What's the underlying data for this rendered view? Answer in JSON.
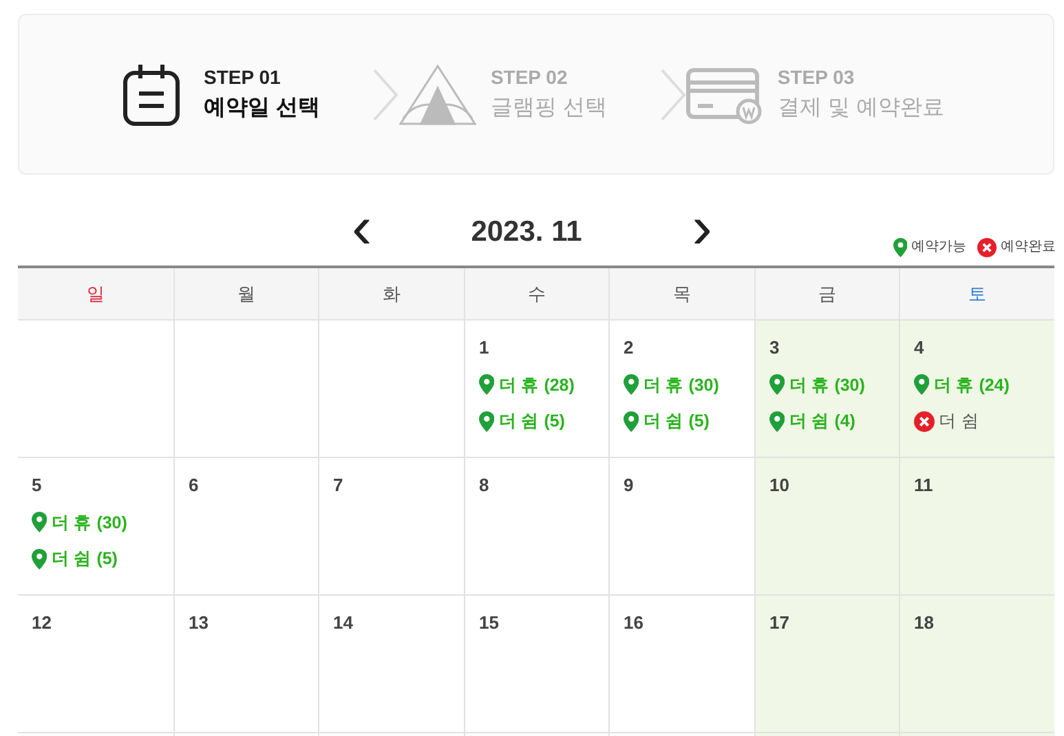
{
  "steps": [
    {
      "kind": "calendar",
      "number": "STEP 01",
      "label": "예약일 선택",
      "selected": true
    },
    {
      "kind": "tent",
      "number": "STEP 02",
      "label": "글램핑 선택",
      "selected": false
    },
    {
      "kind": "card",
      "number": "STEP 03",
      "label": "결제 및 예약완료",
      "selected": false
    }
  ],
  "calendar": {
    "prev": "‹",
    "title": "2023. 11",
    "next": "›",
    "legend": [
      {
        "kind": "available",
        "label": "예약가능"
      },
      {
        "kind": "booked",
        "label": "예약완료"
      }
    ],
    "weekdays": [
      {
        "label": "일",
        "color": "#e0263a"
      },
      {
        "label": "월",
        "color": "#555555"
      },
      {
        "label": "화",
        "color": "#555555"
      },
      {
        "label": "수",
        "color": "#555555"
      },
      {
        "label": "목",
        "color": "#555555"
      },
      {
        "label": "금",
        "color": "#555555"
      },
      {
        "label": "토",
        "color": "#2f7fd8"
      }
    ],
    "weeks": [
      [
        {
          "highlighted": false
        },
        {
          "highlighted": false
        },
        {
          "highlighted": false
        },
        {
          "day": "1",
          "highlighted": false,
          "items": [
            {
              "kind": "available",
              "label": "더 휴 (28)"
            },
            {
              "kind": "available",
              "label": "더 쉼 (5)"
            }
          ]
        },
        {
          "day": "2",
          "highlighted": false,
          "items": [
            {
              "kind": "available",
              "label": "더 휴 (30)"
            },
            {
              "kind": "available",
              "label": "더 쉼 (5)"
            }
          ]
        },
        {
          "day": "3",
          "highlighted": true,
          "items": [
            {
              "kind": "available",
              "label": "더 휴 (30)"
            },
            {
              "kind": "available",
              "label": "더 쉼 (4)"
            }
          ]
        },
        {
          "day": "4",
          "highlighted": true,
          "items": [
            {
              "kind": "available",
              "label": "더 휴 (24)"
            },
            {
              "kind": "booked",
              "label": "더 쉼"
            }
          ]
        }
      ],
      [
        {
          "day": "5",
          "highlighted": false,
          "items": [
            {
              "kind": "available",
              "label": "더 휴 (30)"
            },
            {
              "kind": "available",
              "label": "더 쉼 (5)"
            }
          ]
        },
        {
          "day": "6",
          "highlighted": false
        },
        {
          "day": "7",
          "highlighted": false
        },
        {
          "day": "8",
          "highlighted": false
        },
        {
          "day": "9",
          "highlighted": false
        },
        {
          "day": "10",
          "highlighted": true
        },
        {
          "day": "11",
          "highlighted": true
        }
      ],
      [
        {
          "day": "12",
          "highlighted": false
        },
        {
          "day": "13",
          "highlighted": false
        },
        {
          "day": "14",
          "highlighted": false
        },
        {
          "day": "15",
          "highlighted": false
        },
        {
          "day": "16",
          "highlighted": false
        },
        {
          "day": "17",
          "highlighted": true
        },
        {
          "day": "18",
          "highlighted": true
        }
      ]
    ]
  }
}
